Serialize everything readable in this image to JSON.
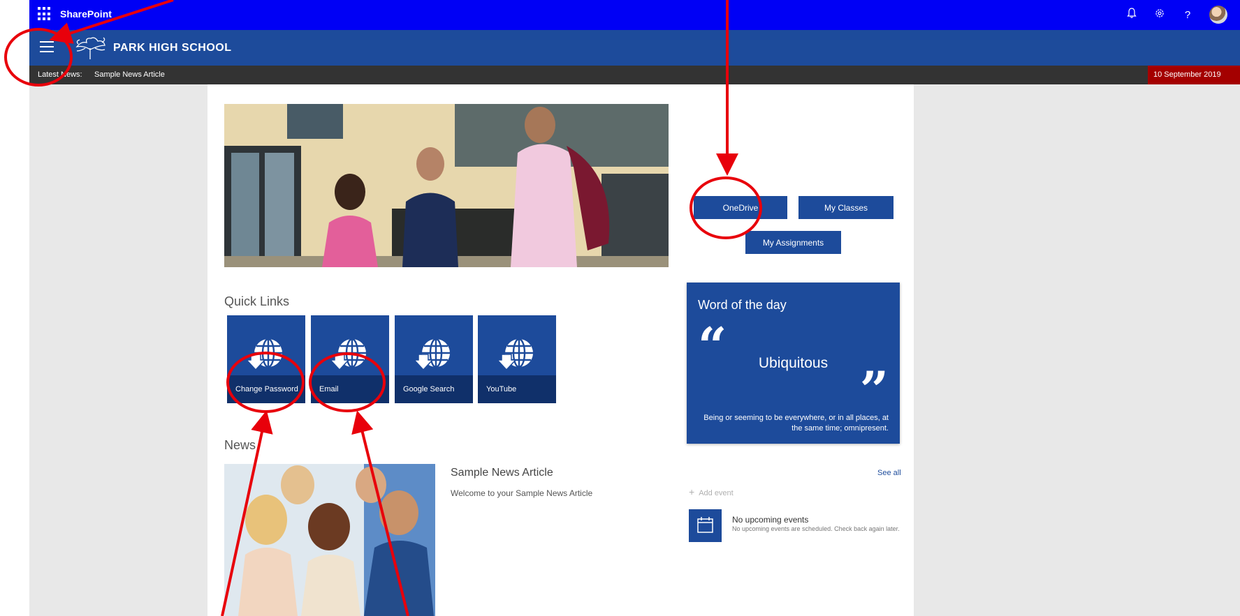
{
  "suite": {
    "title": "SharePoint",
    "icons": [
      "bell-icon",
      "gear-icon",
      "help-icon",
      "avatar"
    ],
    "help_glyph": "?"
  },
  "site": {
    "name": "PARK HIGH SCHOOL"
  },
  "newsbar": {
    "label": "Latest News:",
    "item": "Sample News Article",
    "date": "10 September 2019"
  },
  "buttons": {
    "onedrive": "OneDrive",
    "my_classes": "My Classes",
    "my_assignments": "My Assignments"
  },
  "quick_links": {
    "title": "Quick Links",
    "items": [
      {
        "label": "Change Password",
        "icon": "globe-icon"
      },
      {
        "label": "Email",
        "icon": "globe-icon"
      },
      {
        "label": "Google Search",
        "icon": "globe-icon"
      },
      {
        "label": "YouTube",
        "icon": "globe-icon"
      }
    ]
  },
  "word_of_day": {
    "title": "Word of the day",
    "word": "Ubiquitous",
    "definition": "Being or seeming to be everywhere, or in all places, at the same time; omnipresent.",
    "quote_open": "“",
    "quote_close": "”"
  },
  "news": {
    "title": "News",
    "article_title": "Sample News Article",
    "article_desc": "Welcome to your Sample News Article"
  },
  "events": {
    "see_all": "See all",
    "add_event": "Add event",
    "add_glyph": "+",
    "empty_title": "No upcoming events",
    "empty_desc": "No upcoming events are scheduled. Check back again later."
  },
  "colors": {
    "suite_bar": "#0000f5",
    "brand": "#1d4b9b",
    "news_bar": "#333333",
    "date_badge": "#a40000",
    "annotation": "#e8000b"
  }
}
